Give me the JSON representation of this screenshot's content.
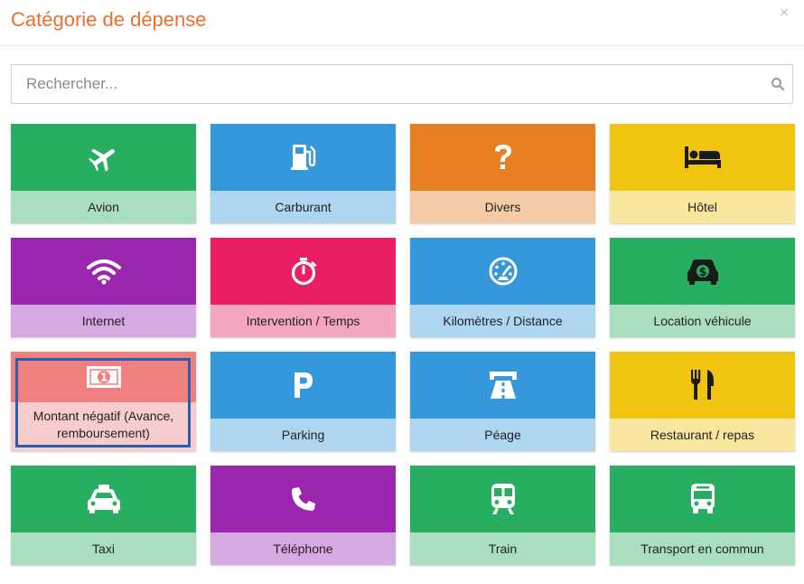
{
  "dialog": {
    "title": "Catégorie de dépense",
    "close_label": "×"
  },
  "search": {
    "placeholder": "Rechercher..."
  },
  "colors": {
    "title": "#e8712c",
    "green": "#27ae60",
    "green_light": "#a9dfbf",
    "blue": "#3498db",
    "blue_light": "#aed6f1",
    "orange": "#e67e22",
    "orange_light": "#f5cba7",
    "yellow": "#f1c40f",
    "yellow_light": "#f9e79f",
    "purple": "#9b27af",
    "purple_light": "#d7a9e3",
    "pink": "#e91e63",
    "pink_light": "#f4a6c0",
    "salmon": "#f08080",
    "salmon_light": "#f8cccc",
    "selection": "#2a5fae"
  },
  "categories": [
    {
      "label": "Avion",
      "icon": "plane-icon",
      "color": "green"
    },
    {
      "label": "Carburant",
      "icon": "gas-pump-icon",
      "color": "blue"
    },
    {
      "label": "Divers",
      "icon": "question-icon",
      "color": "orange"
    },
    {
      "label": "Hôtel",
      "icon": "bed-icon",
      "color": "yellow"
    },
    {
      "label": "Internet",
      "icon": "wifi-icon",
      "color": "purple"
    },
    {
      "label": "Intervention / Temps",
      "icon": "stopwatch-icon",
      "color": "pink"
    },
    {
      "label": "Kilomètres / Distance",
      "icon": "speedometer-icon",
      "color": "blue"
    },
    {
      "label": "Location véhicule",
      "icon": "car-dollar-icon",
      "color": "green"
    },
    {
      "label": "Montant négatif (Avance, remboursement)",
      "icon": "banknote-icon",
      "color": "salmon",
      "selected": true
    },
    {
      "label": "Parking",
      "icon": "parking-icon",
      "color": "blue"
    },
    {
      "label": "Péage",
      "icon": "toll-road-icon",
      "color": "blue"
    },
    {
      "label": "Restaurant / repas",
      "icon": "utensils-icon",
      "color": "yellow"
    },
    {
      "label": "Taxi",
      "icon": "taxi-icon",
      "color": "green"
    },
    {
      "label": "Téléphone",
      "icon": "phone-icon",
      "color": "purple"
    },
    {
      "label": "Train",
      "icon": "train-icon",
      "color": "green"
    },
    {
      "label": "Transport en commun",
      "icon": "bus-icon",
      "color": "green"
    }
  ]
}
